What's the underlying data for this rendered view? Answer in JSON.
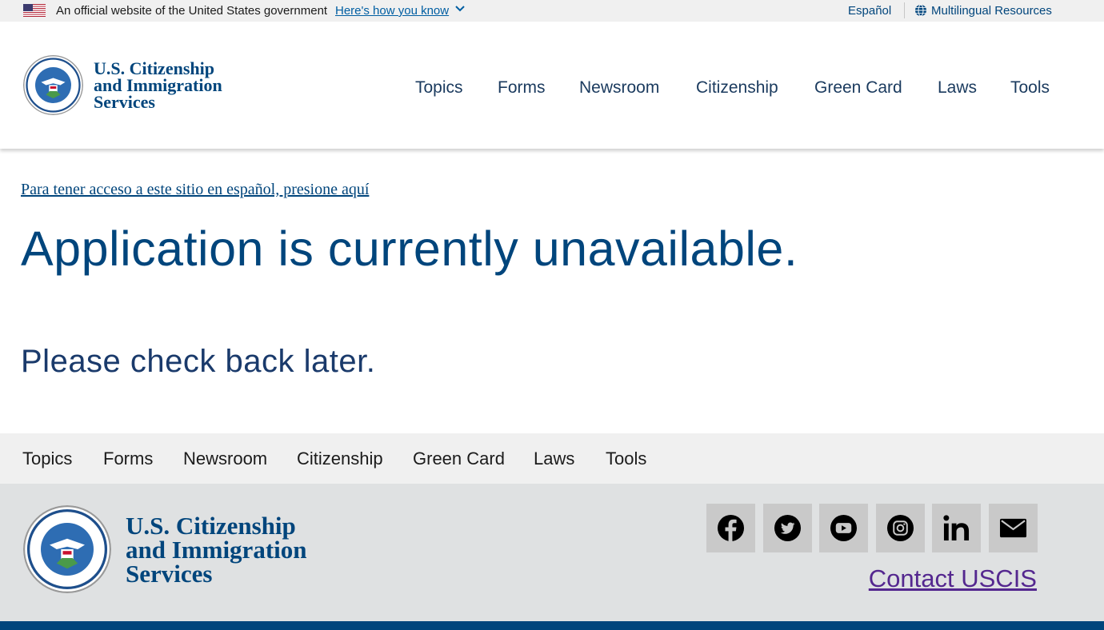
{
  "gov_banner": {
    "official_text": "An official website of the United States government",
    "how_you_know": "Here's how you know",
    "espanol": "Español",
    "multilingual": "Multilingual Resources"
  },
  "header": {
    "logo_lines": [
      "U.S. Citizenship",
      "and Immigration",
      "Services"
    ],
    "nav": [
      "Topics",
      "Forms",
      "Newsroom",
      "Citizenship",
      "Green Card",
      "Laws",
      "Tools"
    ]
  },
  "main": {
    "spanish_link": "Para tener acceso a este sitio en español, presione aquí",
    "title": "Application is currently unavailable.",
    "subtitle": "Please check back later."
  },
  "footer": {
    "nav": [
      "Topics",
      "Forms",
      "Newsroom",
      "Citizenship",
      "Green Card",
      "Laws",
      "Tools"
    ],
    "logo_lines": [
      "U.S. Citizenship",
      "and Immigration",
      "Services"
    ],
    "social": [
      "facebook-icon",
      "twitter-icon",
      "youtube-icon",
      "instagram-icon",
      "linkedin-icon",
      "email-icon"
    ],
    "contact": "Contact USCIS"
  },
  "colors": {
    "brand_blue": "#00457c",
    "visited_link": "#54278f",
    "footer_bg": "#dfe1e2",
    "footer_nav_bg": "#f0f0f0"
  }
}
